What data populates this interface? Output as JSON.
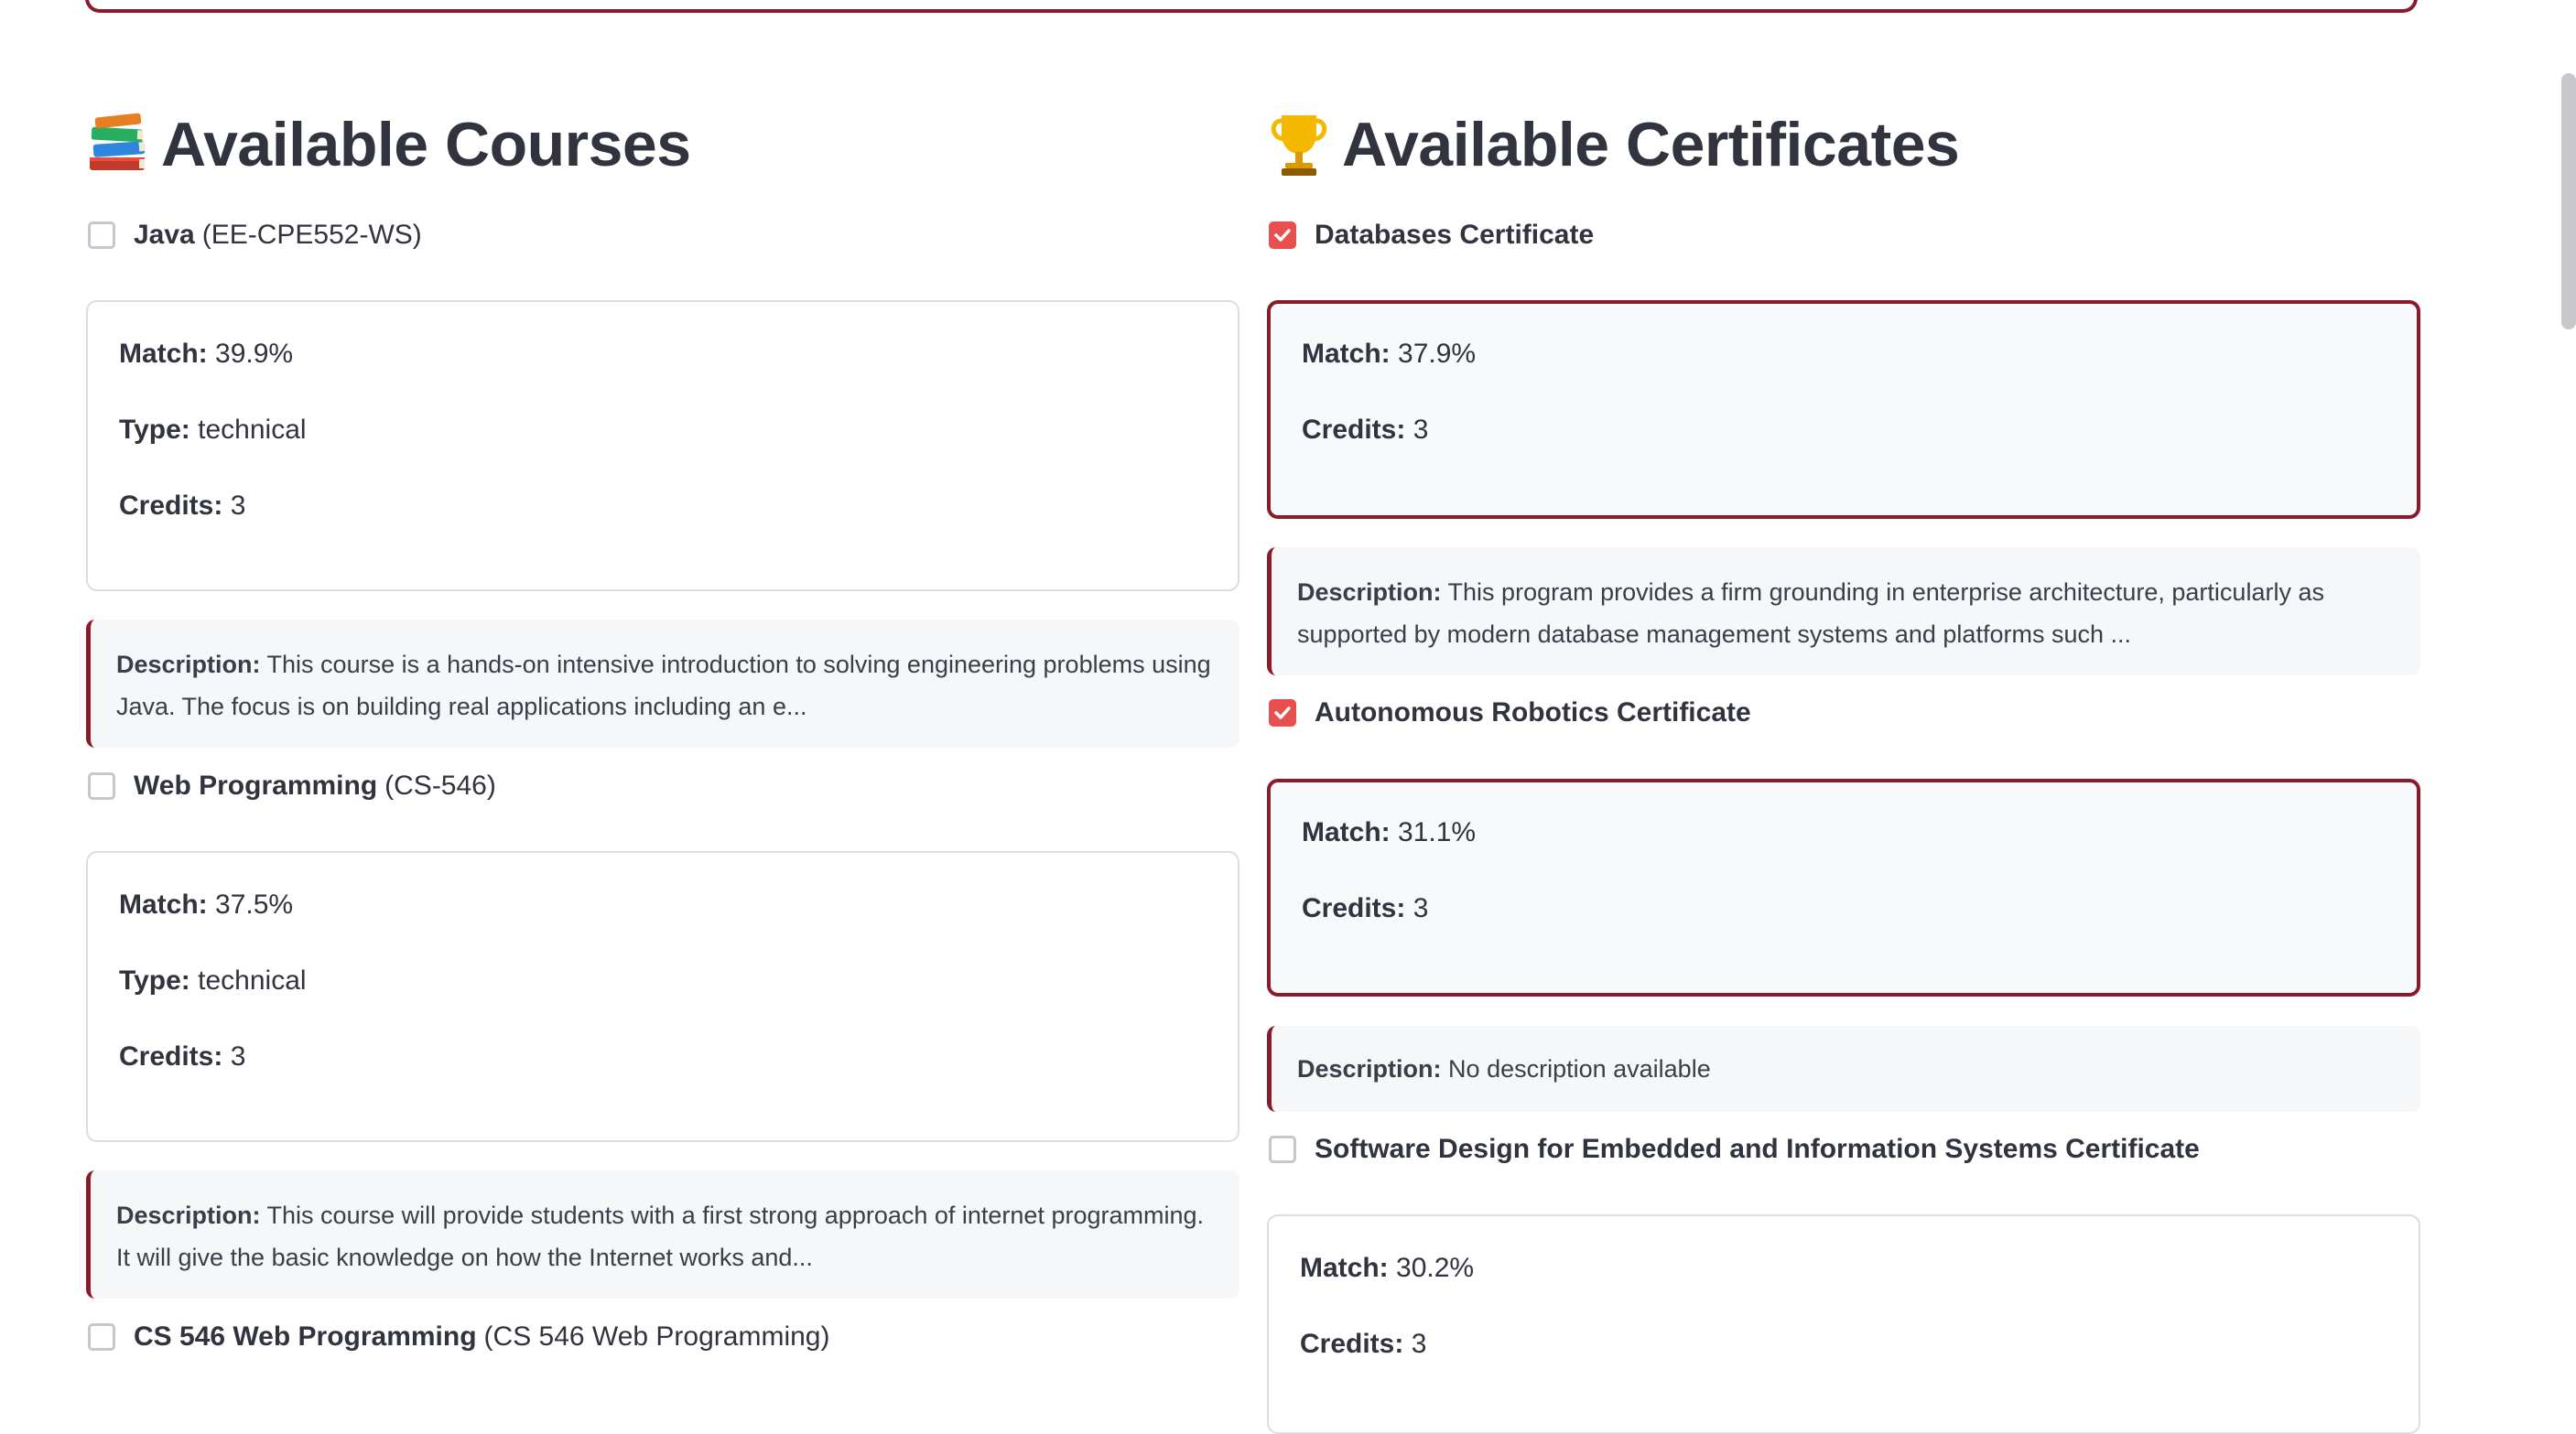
{
  "courses_section": {
    "heading": "Available Courses",
    "icon": "books-icon",
    "items": [
      {
        "name": "Java",
        "code": "(EE-CPE552-WS)",
        "checked": false,
        "match_label": "Match:",
        "match": "39.9%",
        "type_label": "Type:",
        "type": "technical",
        "credits_label": "Credits:",
        "credits": "3",
        "description_label": "Description:",
        "description": "This course is a hands-on intensive introduction to solving engineering problems using Java. The focus is on building real applications including an e..."
      },
      {
        "name": "Web Programming",
        "code": "(CS-546)",
        "checked": false,
        "match_label": "Match:",
        "match": "37.5%",
        "type_label": "Type:",
        "type": "technical",
        "credits_label": "Credits:",
        "credits": "3",
        "description_label": "Description:",
        "description": "This course will provide students with a first strong approach of internet programming. It will give the basic knowledge on how the Internet works and..."
      },
      {
        "name": "CS 546 Web Programming",
        "code": "(CS 546 Web Programming)",
        "checked": false
      }
    ]
  },
  "certificates_section": {
    "heading": "Available Certificates",
    "icon": "trophy-icon",
    "items": [
      {
        "name": "Databases Certificate",
        "checked": true,
        "match_label": "Match:",
        "match": "37.9%",
        "credits_label": "Credits:",
        "credits": "3",
        "description_label": "Description:",
        "description": "This program provides a firm grounding in enterprise architecture, particularly as supported by modern database management systems and platforms such ..."
      },
      {
        "name": "Autonomous Robotics Certificate",
        "checked": true,
        "match_label": "Match:",
        "match": "31.1%",
        "credits_label": "Credits:",
        "credits": "3",
        "description_label": "Description:",
        "description": "No description available"
      },
      {
        "name": "Software Design for Embedded and Information Systems Certificate",
        "checked": false,
        "match_label": "Match:",
        "match": "30.2%",
        "credits_label": "Credits:",
        "credits": "3"
      }
    ]
  },
  "colors": {
    "accent": "#8b1a2b",
    "checkbox_checked": "#e8504f",
    "text": "#31333f"
  }
}
